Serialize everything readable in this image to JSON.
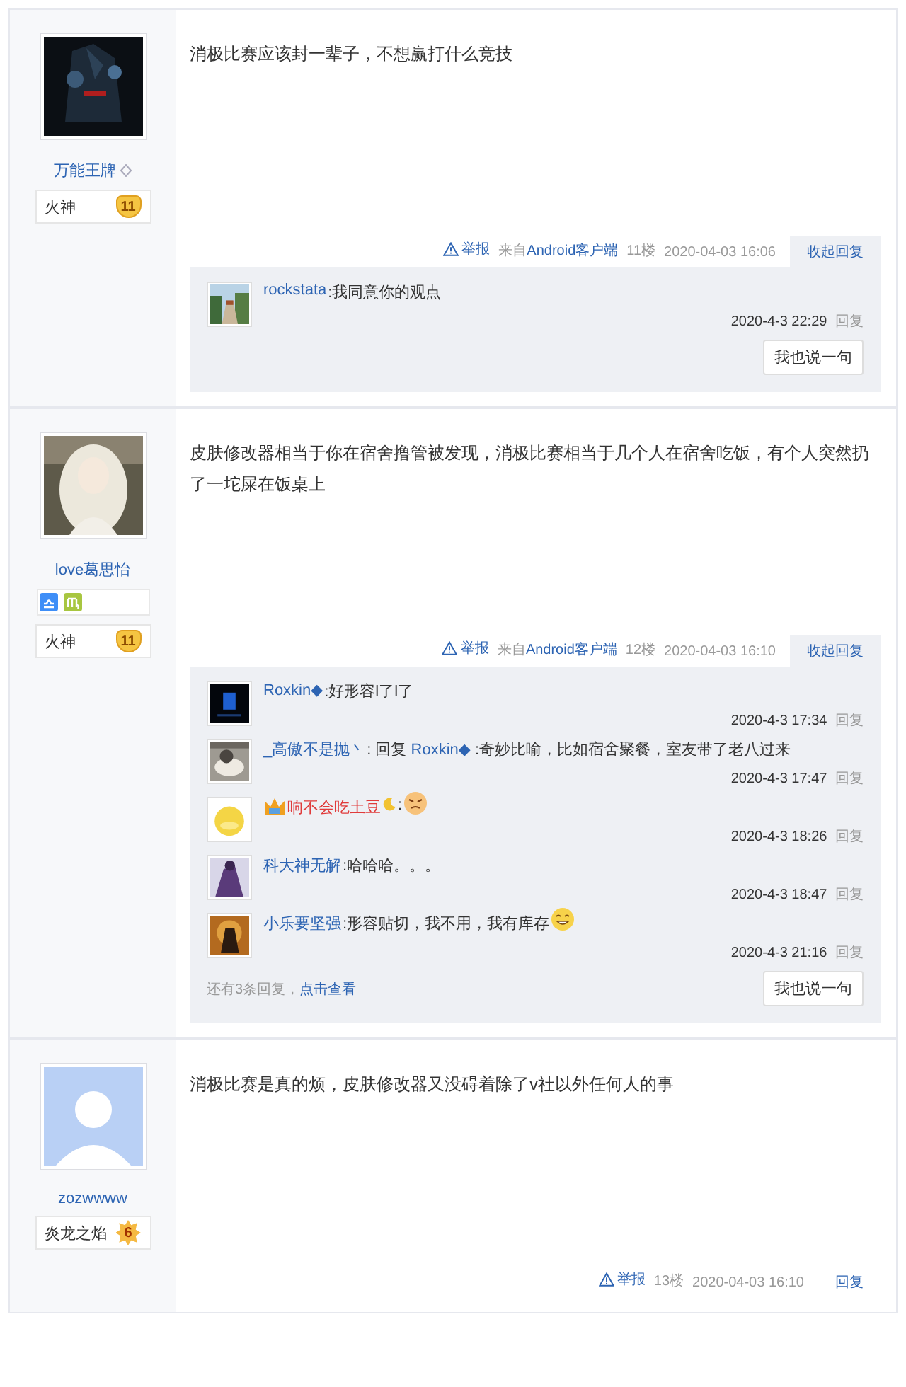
{
  "posts": [
    {
      "avatar": {
        "kind": "picture"
      },
      "author": "万能王牌",
      "vip_mark": true,
      "level_title": "火神",
      "level": {
        "kind": "heart",
        "label": "11"
      },
      "content": "消极比赛应该封一辈子，不想赢打什么竞技",
      "report": "举报",
      "source_prefix": "来自",
      "source_link": "Android客户端",
      "floor": "11楼",
      "time": "2020-04-03 16:06",
      "toggle": "收起回复",
      "replies": [
        {
          "name": "rockstata",
          "text": ":我同意你的观点",
          "time": "2020-4-3 22:29",
          "action": "回复"
        }
      ],
      "say_button": "我也说一句"
    },
    {
      "avatar": {
        "kind": "picture"
      },
      "author": "love葛思怡",
      "badges": [
        {
          "kind": "libra"
        },
        {
          "kind": "virgo"
        }
      ],
      "level_title": "火神",
      "level": {
        "kind": "heart",
        "label": "11"
      },
      "content": "皮肤修改器相当于你在宿舍撸管被发现，消极比赛相当于几个人在宿舍吃饭，有个人突然扔了一坨屎在饭桌上",
      "report": "举报",
      "source_prefix": "来自",
      "source_link": "Android客户端",
      "floor": "12楼",
      "time": "2020-04-03 16:10",
      "toggle": "收起回复",
      "replies": [
        {
          "name": "Roxkin◆",
          "text": ":好形容l了l了",
          "time": "2020-4-3 17:34",
          "action": "回复"
        },
        {
          "name": "_高傲不是抛丶",
          "prefix": ": 回复 ",
          "mention": "Roxkin◆",
          "text": " :奇妙比喻，比如宿舍聚餐，室友带了老八过来",
          "time": "2020-4-3 17:47",
          "action": "回复"
        },
        {
          "name": "响不会吃土豆",
          "color": "#e03b3b",
          "crown": true,
          "moon": true,
          "text": ":",
          "emoji": {
            "kind": "angry"
          },
          "time": "2020-4-3 18:26",
          "action": "回复"
        },
        {
          "name": "科大神无解",
          "text": ":哈哈哈。。。",
          "time": "2020-4-3 18:47",
          "action": "回复"
        },
        {
          "name": "小乐要坚强",
          "text": ":形容贴切，我不用，我有库存",
          "emoji": {
            "kind": "grin"
          },
          "time": "2020-4-3 21:16",
          "action": "回复"
        }
      ],
      "more_text": "还有3条回复，",
      "more_link": "点击查看",
      "say_button": "我也说一句"
    },
    {
      "avatar": {
        "kind": "default"
      },
      "author": "zozwwww",
      "level_title": "炎龙之焰",
      "level": {
        "kind": "star",
        "label": "6"
      },
      "content": "消极比赛是真的烦，皮肤修改器又没碍着除了v社以外任何人的事",
      "report": "举报",
      "floor": "13楼",
      "time": "2020-04-03 16:10",
      "toggle": "回复"
    }
  ]
}
